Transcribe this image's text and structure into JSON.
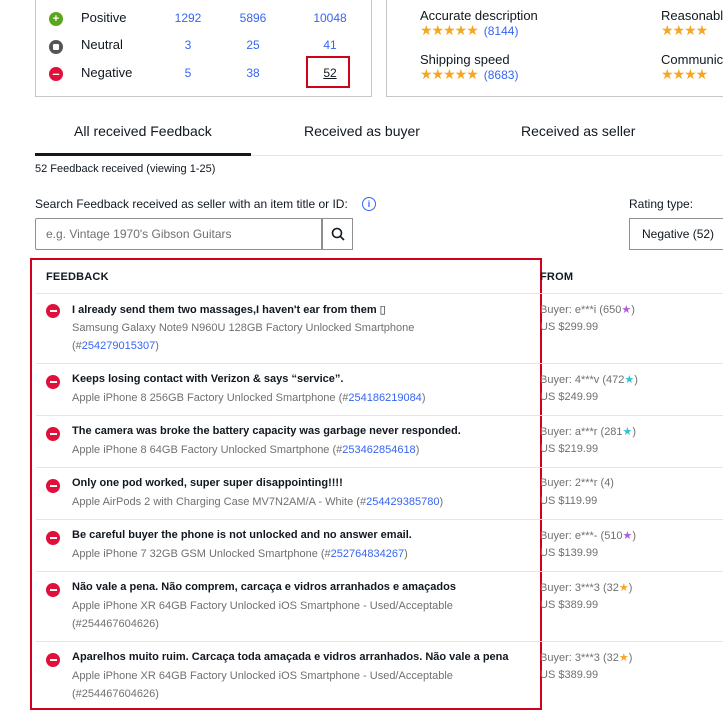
{
  "summary": {
    "rows": [
      {
        "label": "Positive",
        "v1": "1292",
        "v2": "5896",
        "v3": "10048"
      },
      {
        "label": "Neutral",
        "v1": "3",
        "v2": "25",
        "v3": "41"
      },
      {
        "label": "Negative",
        "v1": "5",
        "v2": "38",
        "v3": "52"
      }
    ]
  },
  "dsr": {
    "accurate": {
      "title": "Accurate description",
      "count": "(8144)"
    },
    "shipping": {
      "title": "Shipping speed",
      "count": "(8683)"
    },
    "reasonable": {
      "title": "Reasonable"
    },
    "communication": {
      "title": "Communica"
    }
  },
  "tabs": {
    "all": "All received Feedback",
    "buyer": "Received as buyer",
    "seller": "Received as seller"
  },
  "count_text": "52 Feedback received (viewing 1-25)",
  "search": {
    "label": "Search Feedback received as seller with an item title or ID:",
    "placeholder": "e.g. Vintage 1970's Gibson Guitars"
  },
  "rating_type": {
    "label": "Rating type:",
    "selected": "Negative (52)"
  },
  "table": {
    "col_feedback": "FEEDBACK",
    "col_from": "FROM",
    "rows": [
      {
        "comment": "I already send them two massages,I haven't ear from them ▯",
        "item_line1": "Samsung Galaxy Note9 N960U 128GB Factory Unlocked Smartphone",
        "item_prefix": "(#",
        "item_id": "254279015307",
        "item_suffix": ")",
        "buyer": "Buyer: e***i (650",
        "buyer_suffix": ")",
        "star": "purple",
        "price": "US $299.99"
      },
      {
        "comment": "Keeps losing contact with Verizon & says “service”.",
        "item_line1": "Apple iPhone 8 256GB Factory Unlocked Smartphone (#",
        "item_id": "254186219084",
        "item_suffix": ")",
        "buyer": "Buyer: 4***v (472",
        "buyer_suffix": ")",
        "star": "teal",
        "price": "US $249.99"
      },
      {
        "comment": "The camera was broke the battery capacity was garbage never responded.",
        "item_line1": "Apple iPhone 8 64GB Factory Unlocked Smartphone (#",
        "item_id": "253462854618",
        "item_suffix": ")",
        "buyer": "Buyer: a***r (281",
        "buyer_suffix": ")",
        "star": "teal",
        "price": "US $219.99"
      },
      {
        "comment": "Only one pod worked, super super disappointing!!!!",
        "item_line1": "Apple AirPods 2 with Charging Case MV7N2AM/A - White (#",
        "item_id": "254429385780",
        "item_suffix": ")",
        "buyer": "Buyer: 2***r (4)",
        "price": "US $119.99"
      },
      {
        "comment": "Be careful buyer the phone is not unlocked and no answer email.",
        "item_line1": "Apple iPhone 7 32GB GSM Unlocked Smartphone (#",
        "item_id": "252764834267",
        "item_suffix": ")",
        "buyer": "Buyer: e***- (510",
        "buyer_suffix": ")",
        "star": "purple",
        "price": "US $139.99"
      },
      {
        "comment": "Não vale a pena. Não comprem, carcaça e vidros arranhados e amaçados",
        "item_line1": "Apple iPhone XR 64GB Factory Unlocked iOS Smartphone - Used/Acceptable",
        "item_line2": "(#254467604626)",
        "buyer": "Buyer: 3***3 (32",
        "buyer_suffix": ")",
        "star": "yellow",
        "price": "US $389.99"
      },
      {
        "comment": "Aparelhos muito ruim. Carcaça toda amaçada e vidros arranhados. Não vale a pena",
        "item_line1": "Apple iPhone XR 64GB Factory Unlocked iOS Smartphone - Used/Acceptable",
        "item_line2": "(#254467604626)",
        "buyer": "Buyer: 3***3 (32",
        "buyer_suffix": ")",
        "star": "yellow",
        "price": "US $389.99"
      }
    ]
  }
}
